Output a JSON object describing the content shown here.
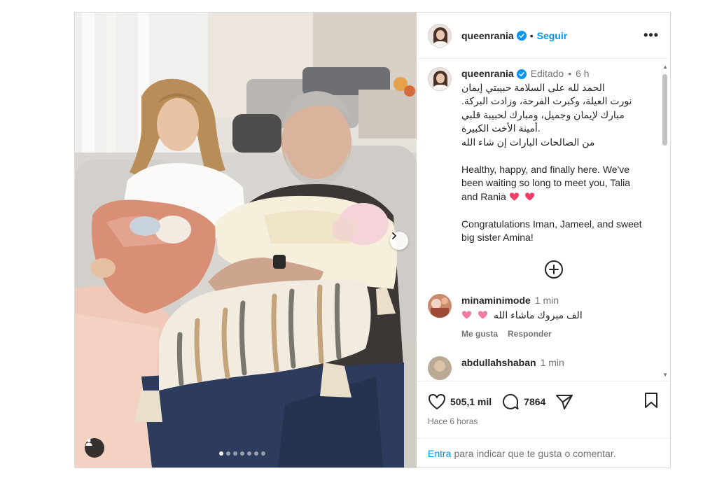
{
  "post": {
    "author": "queenrania",
    "follow_label": "Seguir",
    "separator": "•",
    "more_label": "•••"
  },
  "caption": {
    "author": "queenrania",
    "edited": "Editado",
    "separator": "•",
    "time": "6 h",
    "lines_ar": [
      "الحمد لله على السلامة حبيبتي إيمان",
      "نورت العيلة، وكبرت الفرحة، وزادت البركة.",
      "مبارك لإيمان وجميل، ومبارك لحبيبة قلبي",
      ".أمينة الأخت الكبيرة",
      "من الصالحات البارات إن شاء الله"
    ],
    "text_en_1": "Healthy, happy, and finally here. We've been waiting so long to meet you, Talia and Rania",
    "text_en_2": "Congratulations Iman, Jameel, and sweet big sister Amina!"
  },
  "comments": [
    {
      "user": "minaminimode",
      "time": "1 min",
      "text": "الف مبروك ماشاء الله",
      "like_label": "Me gusta",
      "reply_label": "Responder"
    },
    {
      "user": "abdullahshaban",
      "time": "1 min"
    }
  ],
  "stats": {
    "likes": "505,1 mil",
    "comments": "7864",
    "timestamp": "Hace 6 horas"
  },
  "login_prompt": {
    "link": "Entra",
    "text": "para indicar que te gusta o comentar."
  },
  "carousel": {
    "total": 7,
    "current": 1
  },
  "colors": {
    "accent": "#0095f6",
    "heart": "#ed4067",
    "verified": "#0095f6",
    "muted": "#737373"
  },
  "icons": [
    "verified-badge-icon",
    "more-options-icon",
    "add-comments-icon",
    "heart-icon",
    "comment-icon",
    "share-icon",
    "bookmark-icon",
    "next-chevron-icon",
    "user-tag-icon"
  ]
}
